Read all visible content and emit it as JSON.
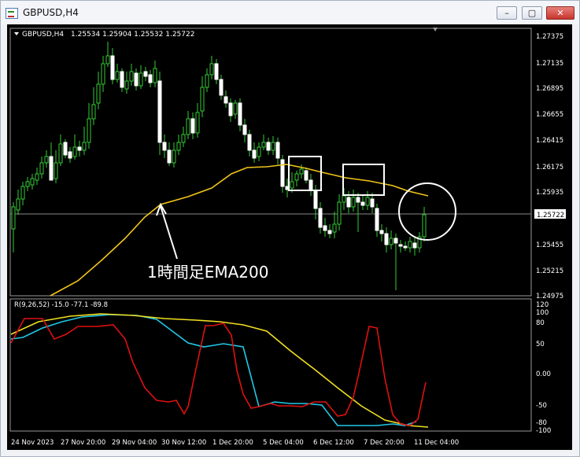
{
  "window": {
    "title": "GBPUSD,H4"
  },
  "controls": {
    "minimize": "–",
    "maximize": "▢",
    "close": "✕"
  },
  "chart_header": {
    "symbol": "GBPUSD,H4",
    "ohlc": "1.25534 1.25904 1.25532 1.25722"
  },
  "price_axis": [
    "1.27375",
    "1.27135",
    "1.26895",
    "1.26655",
    "1.26415",
    "1.26175",
    "1.25935",
    "1.25722",
    "1.25455",
    "1.25215",
    "1.24975"
  ],
  "indicator": {
    "label": "R(9,26,52) -15.0 -77.1 -89.8",
    "axis": [
      "120",
      "100",
      "80",
      "50",
      "0.00",
      "-50",
      "-80",
      "-100"
    ]
  },
  "time_axis": [
    "24 Nov 2023",
    "27 Nov 20:00",
    "29 Nov 04:00",
    "30 Nov 12:00",
    "1 Dec 20:00",
    "5 Dec 04:00",
    "6 Dec 12:00",
    "7 Dec 20:00",
    "11 Dec 04:00"
  ],
  "annotation": {
    "text": "1時間足EMA200"
  },
  "colors": {
    "bull": "#33cc33",
    "bear": "#ffffff",
    "ema": "#f0c419",
    "rsi_red": "#e01010",
    "rsi_cyan": "#20c8e8",
    "rsi_yellow": "#f0e020"
  },
  "chart_data": {
    "type": "line",
    "series": [
      {
        "name": "EMA200",
        "values": [
          1.2488,
          1.251,
          1.254,
          1.2568,
          1.259,
          1.2598,
          1.2606,
          1.2618,
          1.2618,
          1.262,
          1.2615,
          1.2602,
          1.259
        ]
      }
    ],
    "ylim": [
      1.24975,
      1.27375
    ]
  }
}
